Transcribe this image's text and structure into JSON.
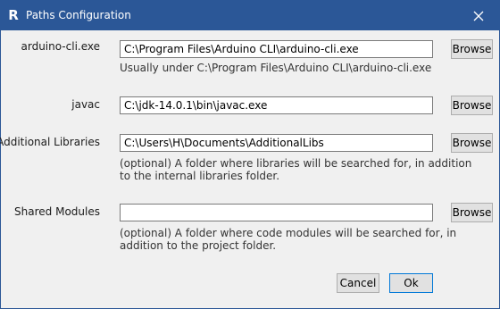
{
  "window": {
    "title": "Paths Configuration"
  },
  "icons": {
    "app": "R",
    "close": "close-icon"
  },
  "colors": {
    "titlebar": "#2b5797",
    "dialog_bg": "#f0f0f0"
  },
  "rows": [
    {
      "label": "arduino-cli.exe",
      "value": "C:\\Program Files\\Arduino CLI\\arduino-cli.exe",
      "browse": "Browse",
      "hint1": "Usually under C:\\Program Files\\Arduino CLI\\arduino-cli.exe",
      "hint2": ""
    },
    {
      "label": "javac",
      "value": "C:\\jdk-14.0.1\\bin\\javac.exe",
      "browse": "Browse",
      "hint1": "",
      "hint2": ""
    },
    {
      "label": "Additional Libraries",
      "value": "C:\\Users\\H\\Documents\\AdditionalLibs",
      "browse": "Browse",
      "hint1": "(optional) A folder where libraries will be searched for, in addition",
      "hint2": "to the internal libraries folder."
    },
    {
      "label": "Shared Modules",
      "value": "",
      "browse": "Browse",
      "hint1": "(optional) A folder where code modules will be searched for, in",
      "hint2": "addition to the project folder."
    }
  ],
  "buttons": {
    "cancel": "Cancel",
    "ok": "Ok"
  }
}
